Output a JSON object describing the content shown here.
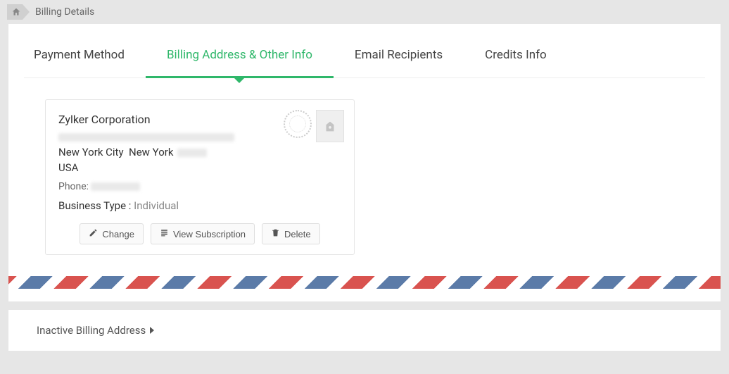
{
  "breadcrumb": {
    "title": "Billing Details"
  },
  "tabs": [
    {
      "label": "Payment Method"
    },
    {
      "label": "Billing Address & Other Info"
    },
    {
      "label": "Email Recipients"
    },
    {
      "label": "Credits Info"
    }
  ],
  "address": {
    "company": "Zylker Corporation",
    "city": "New York City",
    "state": "New York",
    "country": "USA",
    "phone_label": "Phone:",
    "business_type_label": "Business Type :",
    "business_type_value": "Individual"
  },
  "actions": {
    "change": "Change",
    "view_subscription": "View Subscription",
    "delete": "Delete"
  },
  "inactive": {
    "label": "Inactive Billing Address"
  }
}
